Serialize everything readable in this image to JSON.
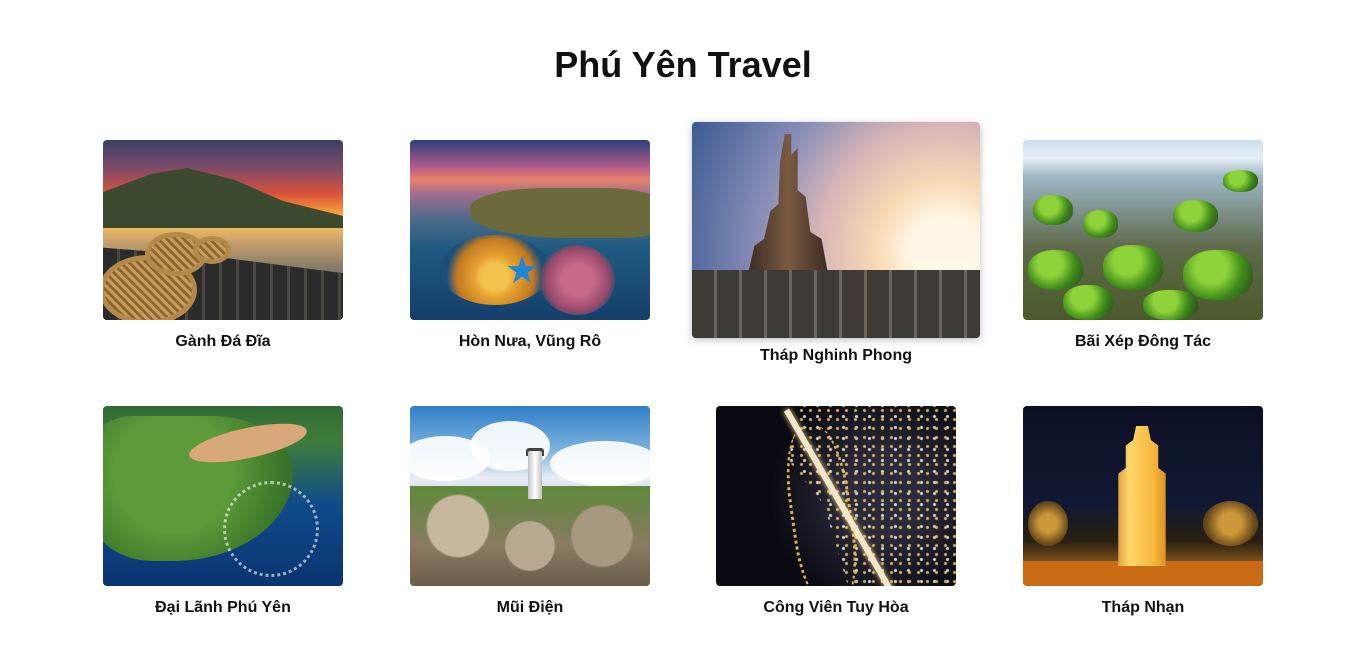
{
  "header": {
    "title": "Phú Yên Travel"
  },
  "destinations": [
    {
      "name": "Gành Đá Đĩa"
    },
    {
      "name": "Hòn Nưa, Vũng Rô"
    },
    {
      "name": "Tháp Nghinh Phong"
    },
    {
      "name": "Bãi Xép Đông Tác"
    },
    {
      "name": "Đại Lãnh Phú Yên"
    },
    {
      "name": "Mũi Điện"
    },
    {
      "name": "Công Viên Tuy Hòa"
    },
    {
      "name": "Tháp Nhạn"
    }
  ]
}
